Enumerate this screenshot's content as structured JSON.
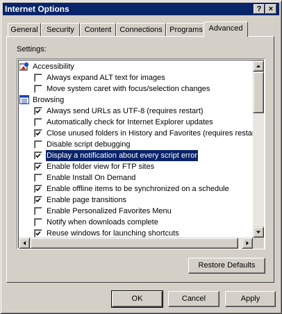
{
  "window": {
    "title": "Internet Options",
    "help_button": "?",
    "close_button": "×"
  },
  "tabs": [
    {
      "label": "General"
    },
    {
      "label": "Security"
    },
    {
      "label": "Content"
    },
    {
      "label": "Connections"
    },
    {
      "label": "Programs"
    },
    {
      "label": "Advanced",
      "active": true
    }
  ],
  "settings": {
    "label": "Settings:",
    "items": [
      {
        "type": "category",
        "label": "Accessibility",
        "icon": "accessibility-icon"
      },
      {
        "type": "checkbox",
        "label": "Always expand ALT text for images",
        "checked": false
      },
      {
        "type": "checkbox",
        "label": "Move system caret with focus/selection changes",
        "checked": false
      },
      {
        "type": "category",
        "label": "Browsing",
        "icon": "browsing-icon"
      },
      {
        "type": "checkbox",
        "label": "Always send URLs as UTF-8 (requires restart)",
        "checked": true
      },
      {
        "type": "checkbox",
        "label": "Automatically check for Internet Explorer updates",
        "checked": false
      },
      {
        "type": "checkbox",
        "label": "Close unused folders in History and Favorites (requires restart)",
        "checked": true
      },
      {
        "type": "checkbox",
        "label": "Disable script debugging",
        "checked": false
      },
      {
        "type": "checkbox",
        "label": "Display a notification about every script error",
        "checked": true,
        "selected": true
      },
      {
        "type": "checkbox",
        "label": "Enable folder view for FTP sites",
        "checked": true
      },
      {
        "type": "checkbox",
        "label": "Enable Install On Demand",
        "checked": false
      },
      {
        "type": "checkbox",
        "label": "Enable offline items to be synchronized on a schedule",
        "checked": true
      },
      {
        "type": "checkbox",
        "label": "Enable page transitions",
        "checked": true
      },
      {
        "type": "checkbox",
        "label": "Enable Personalized Favorites Menu",
        "checked": false
      },
      {
        "type": "checkbox",
        "label": "Notify when downloads complete",
        "checked": false
      },
      {
        "type": "checkbox",
        "label": "Reuse windows for launching shortcuts",
        "checked": true
      }
    ]
  },
  "buttons": {
    "restore_defaults": "Restore Defaults",
    "ok": "OK",
    "cancel": "Cancel",
    "apply": "Apply"
  },
  "colors": {
    "titlebar": "#0a246a",
    "face": "#d4d0c8",
    "selection": "#0a246a"
  }
}
